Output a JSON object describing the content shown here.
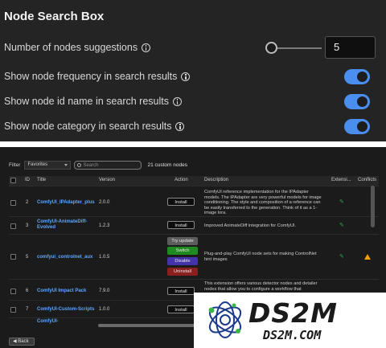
{
  "settings": {
    "title": "Node Search Box",
    "rows": [
      {
        "label": "Number of nodes suggestions",
        "value": "5"
      },
      {
        "label": "Show node frequency in search results",
        "enabled": true
      },
      {
        "label": "Show node id name in search results",
        "enabled": true
      },
      {
        "label": "Show node category in search results",
        "enabled": true
      }
    ],
    "toggle_color": "#4a8ff0"
  },
  "manager": {
    "filter_label": "Filter",
    "filter_value": "Favorites",
    "search_placeholder": "Search",
    "count_text": "21 custom nodes",
    "columns": [
      "ID",
      "Title",
      "Version",
      "Action",
      "Description",
      "Extensi...",
      "Conflicts"
    ],
    "rows": [
      {
        "id": "2",
        "title": "ComfyUI_IPAdapter_plus",
        "version": "2.0.0",
        "actions": [
          "Install"
        ],
        "description": "ComfyUI reference implementation for the IPAdapter models. The IPAdapter are very powerful models for image conditioning. The style and composition of a reference can be easily transferred to the generation. Think of it as a 1-image lora."
      },
      {
        "id": "3",
        "title": "ComfyUI-AnimateDiff-Evolved",
        "version": "1.2.3",
        "actions": [
          "Install"
        ],
        "description": "Improved AnimateDiff integration for ComfyUI."
      },
      {
        "id": "5",
        "title": "comfyui_controlnet_aux",
        "version": "1.0.5",
        "actions": [
          "Try update",
          "Switch",
          "Disable",
          "Uninstall"
        ],
        "description": "Plug-and-play ComfyUI node sets for making ControlNet hint images"
      },
      {
        "id": "6",
        "title": "ComfyUI Impact Pack",
        "version": "7.9.0",
        "actions": [
          "Install"
        ],
        "description": "This extension offers various detector nodes and detailer nodes that allow you to configure a workflow that"
      },
      {
        "id": "7",
        "title": "ComfyUI-Custom-Scripts",
        "version": "1.0.0",
        "actions": [
          "Install"
        ],
        "description": ""
      },
      {
        "title": "ComfyUI-"
      }
    ],
    "back_label": "◀ Back"
  },
  "watermark": {
    "brand": "DS2M",
    "url": "DS2M.COM"
  }
}
